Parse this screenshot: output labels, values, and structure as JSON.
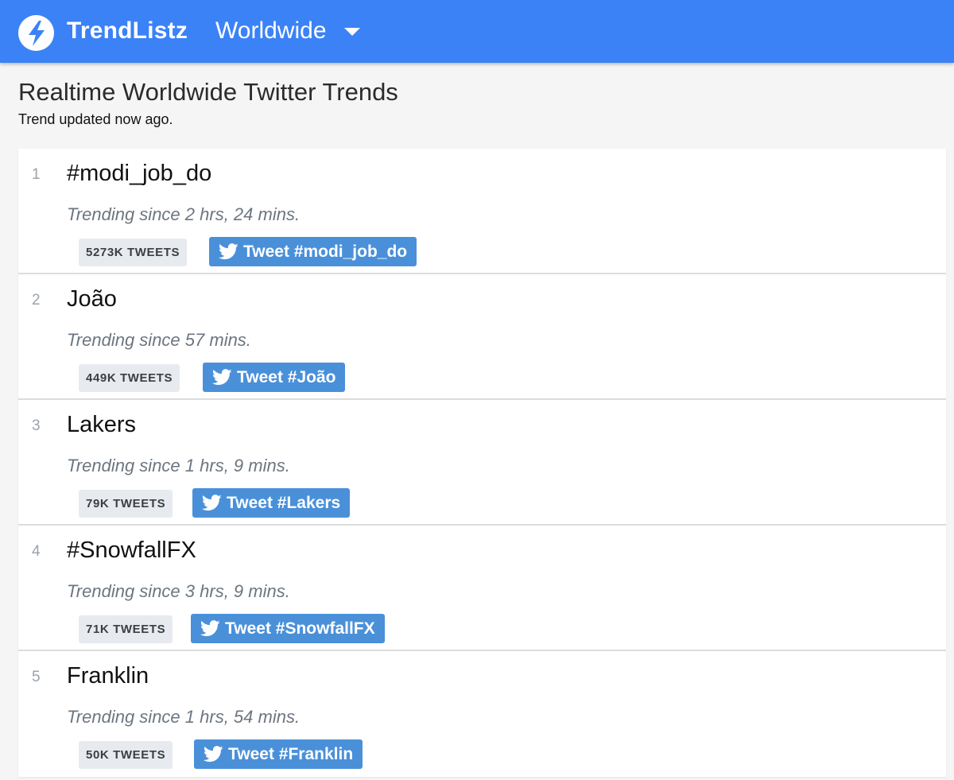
{
  "header": {
    "brand": "TrendListz",
    "region": "Worldwide",
    "logo_icon": "lightning-bolt-icon",
    "region_icon": "caret-down-icon",
    "accent_color": "#3b82f6"
  },
  "page": {
    "title": "Realtime Worldwide Twitter Trends",
    "subtitle": "Trend updated now ago."
  },
  "trends": [
    {
      "rank": "1",
      "name": "#modi_job_do",
      "since": "Trending since 2 hrs, 24 mins.",
      "tweets": "5273K TWEETS",
      "button": "Tweet #modi_job_do"
    },
    {
      "rank": "2",
      "name": "João",
      "since": "Trending since 57 mins.",
      "tweets": "449K TWEETS",
      "button": "Tweet #João"
    },
    {
      "rank": "3",
      "name": "Lakers",
      "since": "Trending since 1 hrs, 9 mins.",
      "tweets": "79K TWEETS",
      "button": "Tweet #Lakers"
    },
    {
      "rank": "4",
      "name": "#SnowfallFX",
      "since": "Trending since 3 hrs, 9 mins.",
      "tweets": "71K TWEETS",
      "button": "Tweet #SnowfallFX"
    },
    {
      "rank": "5",
      "name": "Franklin",
      "since": "Trending since 1 hrs, 54 mins.",
      "tweets": "50K TWEETS",
      "button": "Tweet #Franklin"
    }
  ],
  "button_icon": "twitter-bird-icon",
  "button_color": "#4a90d9"
}
